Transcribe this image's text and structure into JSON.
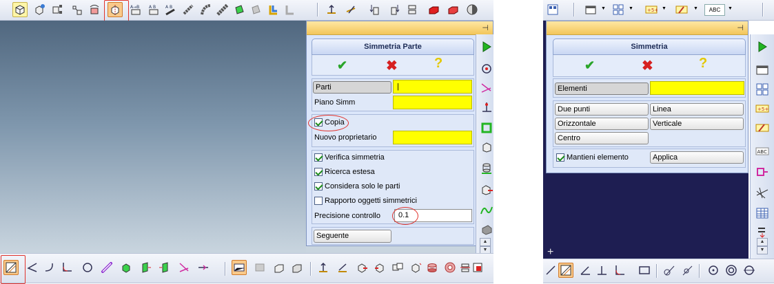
{
  "left_dialog": {
    "title": "Simmetria Parte",
    "fields": {
      "parti_label": "Parti",
      "parti_value": "|",
      "piano_label": "Piano Simm",
      "copia_label": "Copia",
      "nuovo_label": "Nuovo proprietario"
    },
    "options": [
      {
        "label": "Verifica simmetria",
        "checked": true
      },
      {
        "label": "Ricerca estesa",
        "checked": true
      },
      {
        "label": "Considera solo le parti",
        "checked": true
      },
      {
        "label": "Rapporto oggetti simmetrici",
        "checked": false
      }
    ],
    "precision_label": "Precisione controllo",
    "precision_value": "0.1",
    "next_button": "Seguente"
  },
  "right_dialog": {
    "title": "Simmetria",
    "elementi_label": "Elementi",
    "buttons": {
      "due_punti": "Due punti",
      "linea": "Linea",
      "orizzontale": "Orizzontale",
      "verticale": "Verticale",
      "centro": "Centro",
      "applica": "Applica"
    },
    "mantieni_label": "Mantieni elemento"
  },
  "right_toolbar": {
    "abc_label": "ABC"
  },
  "colors": {
    "ok_green": "#2aa52a",
    "cancel_red": "#d62020",
    "help_yellow": "#e3c800",
    "field_yellow": "#ffff00",
    "annotation_red": "#e0322c",
    "viewport_dark": "#1e1e52"
  }
}
